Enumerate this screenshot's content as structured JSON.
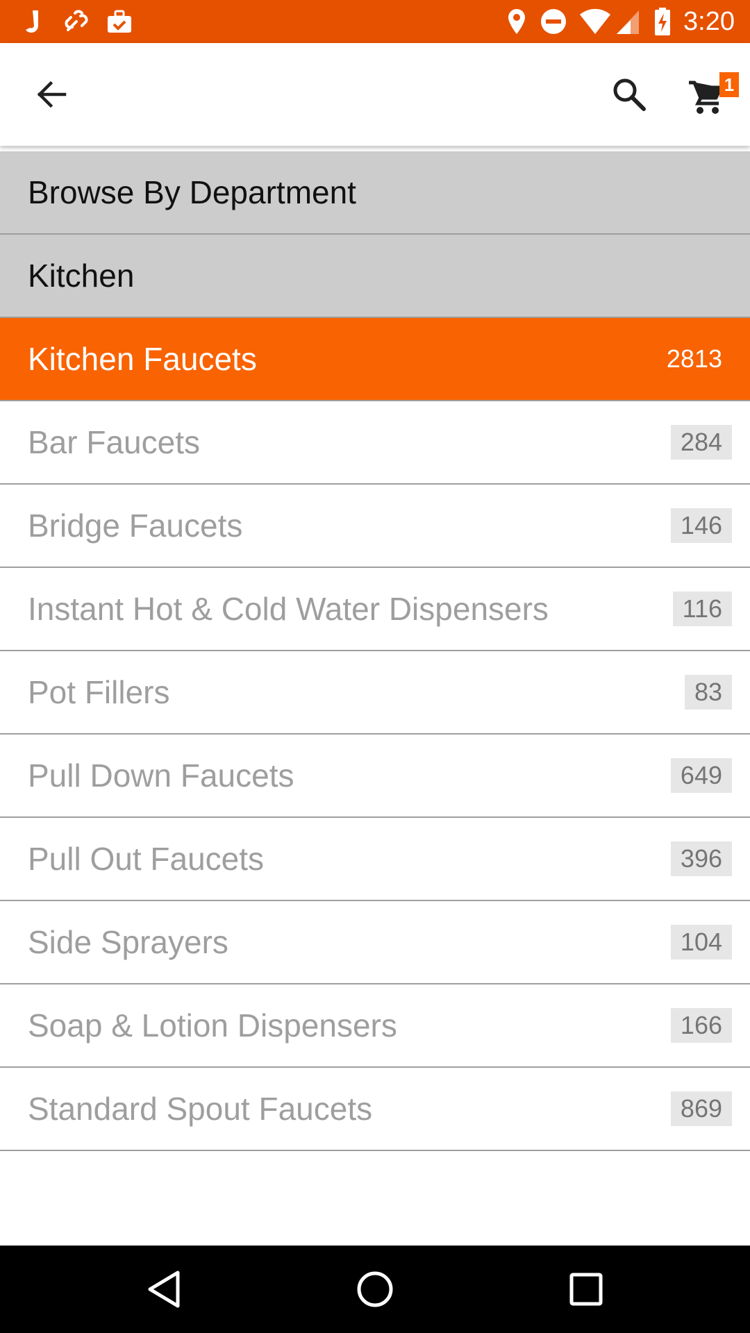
{
  "status_bar": {
    "time": "3:20",
    "left_icons": [
      "j-app-icon",
      "link-app-icon",
      "briefcase-check-icon"
    ],
    "right_icons": [
      "location-icon",
      "do-not-disturb-icon",
      "wifi-icon",
      "cell-signal-icon",
      "battery-charging-icon"
    ],
    "bg_color": "#E65100"
  },
  "app_bar": {
    "back_icon": "arrow-back-icon",
    "search_icon": "search-icon",
    "cart_icon": "cart-icon",
    "cart_count": "1"
  },
  "list": {
    "header": "Browse By Department",
    "department": "Kitchen",
    "selected": {
      "label": "Kitchen Faucets",
      "count": "2813"
    },
    "items": [
      {
        "label": "Bar Faucets",
        "count": "284"
      },
      {
        "label": "Bridge Faucets",
        "count": "146"
      },
      {
        "label": "Instant Hot & Cold Water Dispensers",
        "count": "116"
      },
      {
        "label": "Pot Fillers",
        "count": "83"
      },
      {
        "label": "Pull Down Faucets",
        "count": "649"
      },
      {
        "label": "Pull Out Faucets",
        "count": "396"
      },
      {
        "label": "Side Sprayers",
        "count": "104"
      },
      {
        "label": "Soap & Lotion Dispensers",
        "count": "166"
      },
      {
        "label": "Standard Spout Faucets",
        "count": "869"
      }
    ]
  },
  "colors": {
    "accent": "#F96302",
    "header_bg": "#CCCCCC",
    "item_text": "#9E9E9E"
  },
  "nav_bar": {
    "back": "nav-back-icon",
    "home": "nav-home-icon",
    "recents": "nav-recents-icon"
  }
}
